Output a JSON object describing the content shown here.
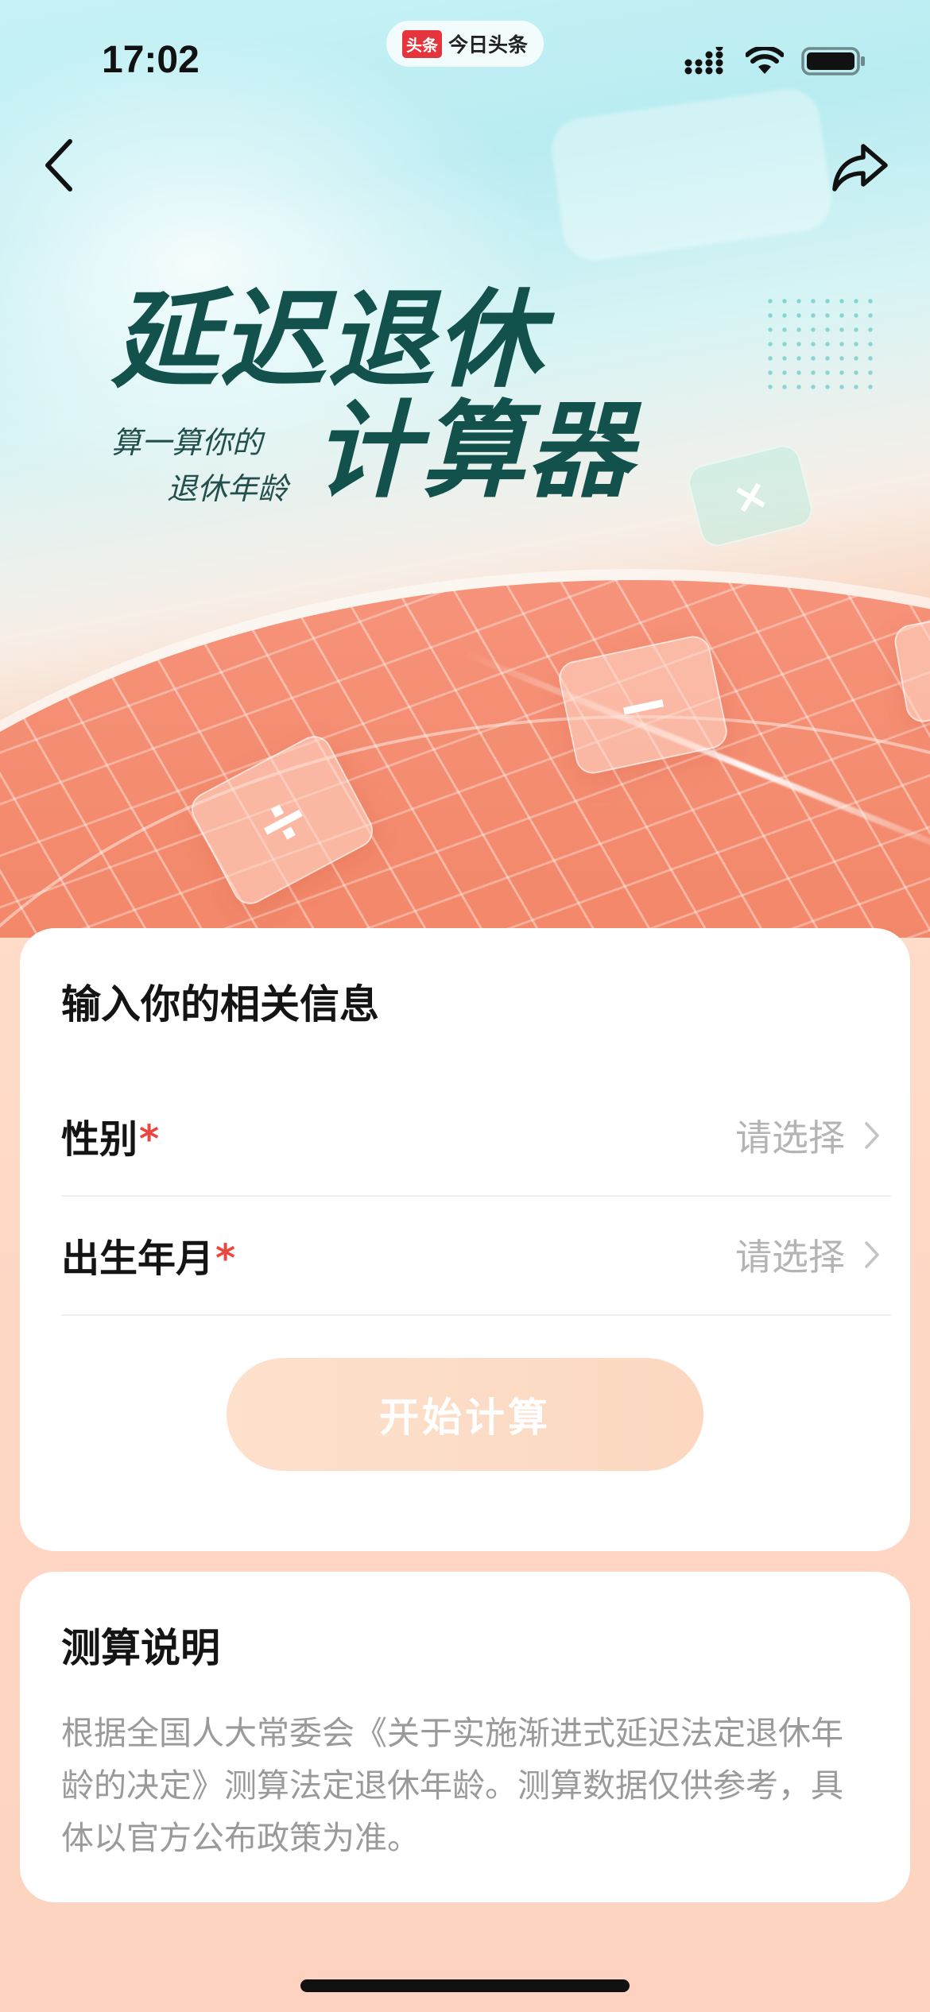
{
  "status_bar": {
    "time": "17:02",
    "app_logo": "头条",
    "app_name": "今日头条",
    "icons": [
      "signal-icon",
      "wifi-icon",
      "battery-icon"
    ]
  },
  "nav": {
    "back_icon": "chevron-left-icon",
    "share_icon": "share-icon"
  },
  "hero": {
    "title_line1": "延迟退休",
    "title_line2": "计算器",
    "subtitle_line1": "算一算你的",
    "subtitle_line2": "退休年龄",
    "decor_symbols": [
      "÷",
      "−",
      "×"
    ]
  },
  "info_card": {
    "title": "输入你的相关信息",
    "fields": [
      {
        "label": "性别",
        "required_mark": "*",
        "value": "请选择"
      },
      {
        "label": "出生年月",
        "required_mark": "*",
        "value": "请选择"
      }
    ],
    "submit_label": "开始计算"
  },
  "note_card": {
    "title": "测算说明",
    "text": "根据全国人大常委会《关于实施渐进式延迟法定退休年龄的决定》测算法定退休年龄。测算数据仅供参考，具体以官方公布政策为准。"
  },
  "colors": {
    "brand_red": "#e5343b",
    "required_red": "#e9473f",
    "title_green": "#13514c",
    "button_disabled": "#fcd8c0",
    "placeholder_gray": "#b4b4b4"
  }
}
